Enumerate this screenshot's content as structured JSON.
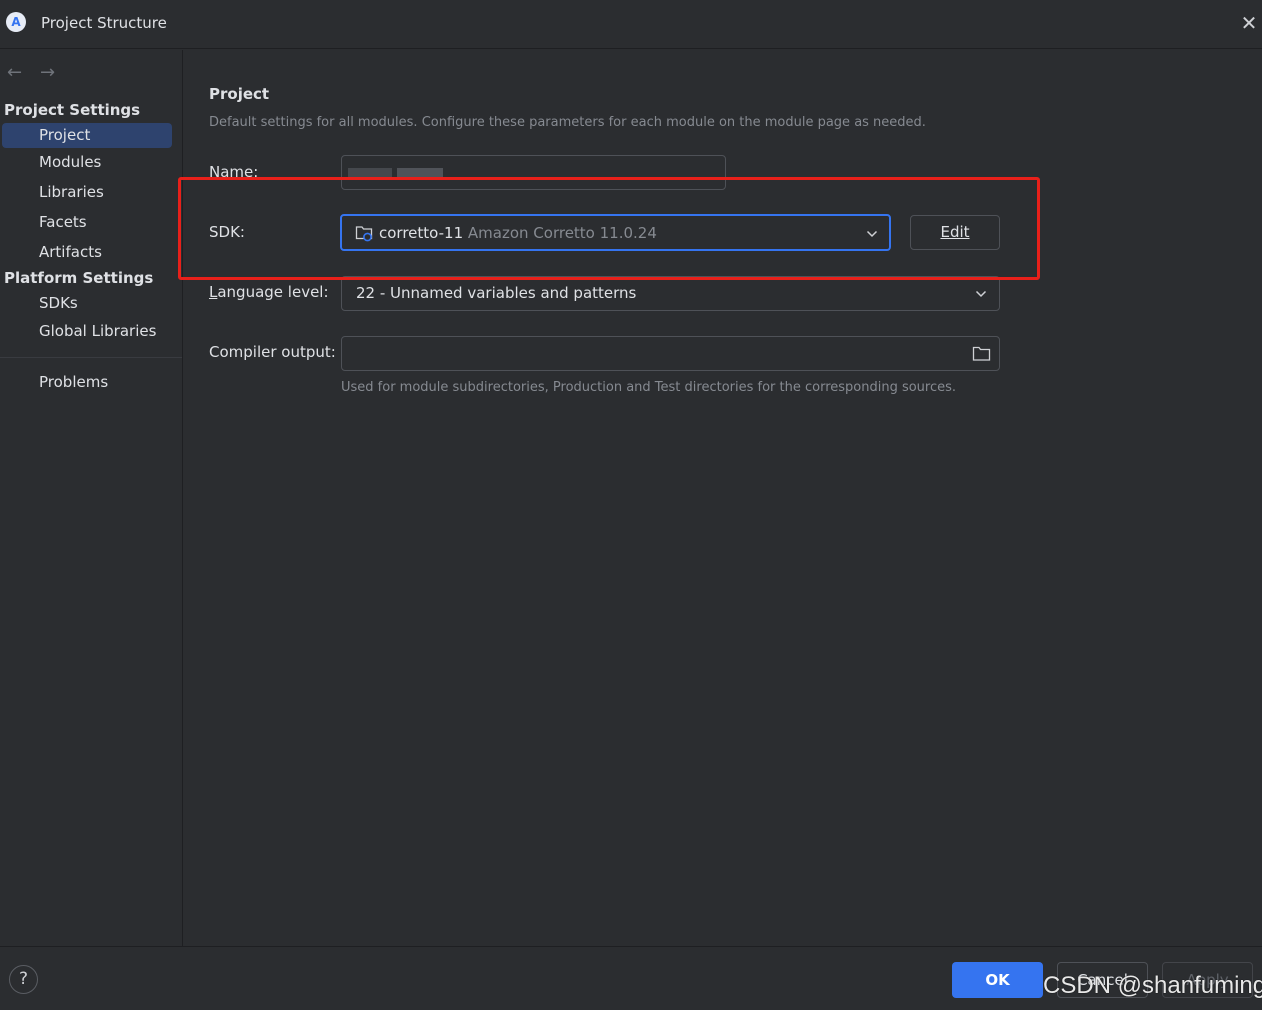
{
  "window": {
    "logo_letter": "A",
    "title": "Project Structure",
    "close_glyph": "✕"
  },
  "sidebar": {
    "back_glyph": "←",
    "forward_glyph": "→",
    "project_settings_title": "Project Settings",
    "project_items": [
      "Project",
      "Modules",
      "Libraries",
      "Facets",
      "Artifacts"
    ],
    "selected_item": "Project",
    "platform_settings_title": "Platform Settings",
    "platform_items": [
      "SDKs",
      "Global Libraries"
    ],
    "problems": "Problems"
  },
  "main": {
    "heading": "Project",
    "description": "Default settings for all modules. Configure these parameters for each module on the module page as needed.",
    "name_label": "Name:",
    "sdk_label": "SDK:",
    "sdk_value": "corretto-11",
    "sdk_detail": "Amazon Corretto 11.0.24",
    "edit_button": "Edit",
    "language_label_first": "L",
    "language_label_rest": "anguage level:",
    "language_value": "22 - Unnamed variables and patterns",
    "compiler_label": "Compiler output:",
    "compiler_value": "",
    "compiler_hint": "Used for module subdirectories, Production and Test directories for the corresponding sources."
  },
  "footer": {
    "help": "?",
    "ok": "OK",
    "cancel": "Cancel",
    "apply": "Apply"
  },
  "watermark": "CSDN @shanfuming",
  "colors": {
    "accent": "#3574f0",
    "highlight_box": "#e8201a",
    "background": "#2b2d30",
    "selection": "#2e436e"
  },
  "icons": [
    "app-logo-icon",
    "close-icon",
    "back-arrow-icon",
    "forward-arrow-icon",
    "jdk-folder-icon",
    "chevron-down-icon",
    "folder-browse-icon",
    "help-icon"
  ]
}
